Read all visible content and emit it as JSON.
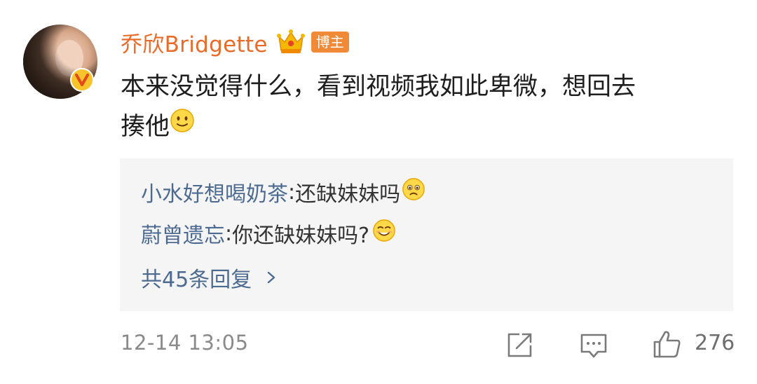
{
  "comment": {
    "username": "乔欣Bridgette",
    "crown_icon": "crown-icon",
    "author_tag": "博主",
    "verified_icon": "verified-v-badge-icon",
    "text": "本来没觉得什么，看到视频我如此卑微，想回去揍他",
    "text_line1": "本来没觉得什么，看到视频我如此卑微，想回去",
    "text_line2": "揍他",
    "text_emoji": "smile-emoji-icon"
  },
  "replies": [
    {
      "user": "小水好想喝奶茶",
      "sep": ": ",
      "text": "还缺妹妹吗",
      "emoji": "sad-emoji-icon"
    },
    {
      "user": "蔚曾遗忘",
      "sep": ": ",
      "text": "你还缺妹妹吗?",
      "emoji": "grin-emoji-icon"
    }
  ],
  "more_replies": {
    "label": "共45条回复",
    "icon": "chevron-right-icon"
  },
  "footer": {
    "timestamp": "12-14 13:05",
    "share_icon": "share-icon",
    "comment_icon": "comment-icon",
    "like_icon": "thumbs-up-icon",
    "like_count": "276"
  },
  "colors": {
    "username": "#e96b2a",
    "author_tag_bg": "#f08a36",
    "reply_user": "#4d6b91",
    "reply_bg": "#f5f5f5",
    "meta_gray": "#8a8a8a"
  }
}
